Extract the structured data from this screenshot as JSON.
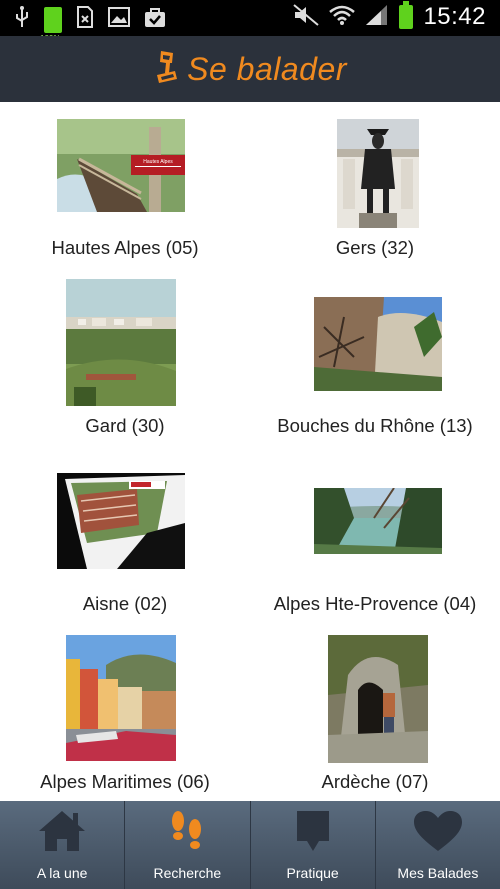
{
  "status_bar": {
    "time": "15:42",
    "battery_small_label": "100%"
  },
  "header": {
    "title": "Se balader"
  },
  "regions": [
    {
      "name": "Hautes Alpes (05)",
      "sign_text": "Hautes Alpes"
    },
    {
      "name": "Gers (32)"
    },
    {
      "name": "Gard (30)"
    },
    {
      "name": "Bouches du Rhône (13)"
    },
    {
      "name": "Aisne (02)"
    },
    {
      "name": "Alpes Hte-Provence (04)"
    },
    {
      "name": "Alpes Maritimes (06)"
    },
    {
      "name": "Ardèche (07)"
    }
  ],
  "bottom_nav": [
    {
      "label": "A la une",
      "icon": "home-icon"
    },
    {
      "label": "Recherche",
      "icon": "footprints-icon"
    },
    {
      "label": "Pratique",
      "icon": "speech-bubble-icon"
    },
    {
      "label": "Mes Balades",
      "icon": "heart-icon"
    }
  ],
  "colors": {
    "accent": "#f08a1f",
    "header_bg": "#2b313b",
    "nav_bg": "#4a5a6c"
  }
}
